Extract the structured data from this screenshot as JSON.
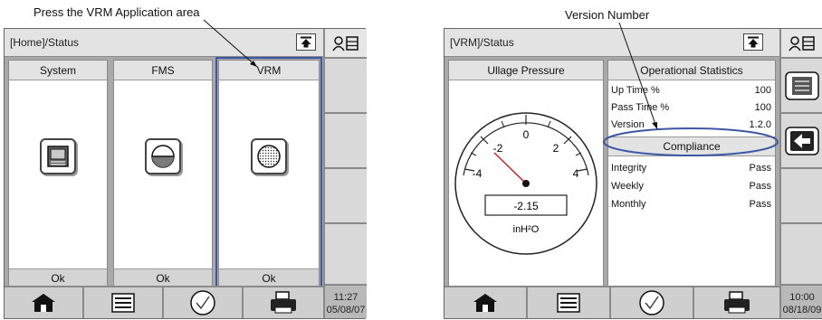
{
  "callouts": {
    "left": "Press the VRM Application area",
    "right": "Version Number"
  },
  "left_screen": {
    "breadcrumb": "[Home]/Status",
    "clock": {
      "time": "11:27",
      "date": "05/08/07"
    },
    "apps": [
      {
        "title": "System",
        "status": "Ok",
        "icon": "console-icon"
      },
      {
        "title": "FMS",
        "status": "Ok",
        "icon": "tank-level-icon"
      },
      {
        "title": "VRM",
        "status": "Ok",
        "icon": "vrm-sensor-icon"
      }
    ]
  },
  "right_screen": {
    "breadcrumb": "[VRM]/Status",
    "clock": {
      "time": "10:00",
      "date": "08/18/09"
    },
    "gauge": {
      "title": "Ullage Pressure",
      "ticks": [
        "-4",
        "-2",
        "0",
        "2",
        "4"
      ],
      "value": "-2.15",
      "unit": "inH²O"
    },
    "stats": {
      "title": "Operational Statistics",
      "rows": [
        {
          "label": "Up Time %",
          "value": "100"
        },
        {
          "label": "Pass Time %",
          "value": "100"
        },
        {
          "label": "Version",
          "value": "1.2.0"
        }
      ]
    },
    "compliance": {
      "title": "Compliance",
      "rows": [
        {
          "label": "Integrity",
          "value": "Pass"
        },
        {
          "label": "Weekly",
          "value": "Pass"
        },
        {
          "label": "Monthly",
          "value": "Pass"
        }
      ]
    }
  },
  "colors": {
    "highlight": "#3d57a5",
    "screen_bg": "#a9a9a9",
    "header_bg": "#e3e3e3"
  }
}
